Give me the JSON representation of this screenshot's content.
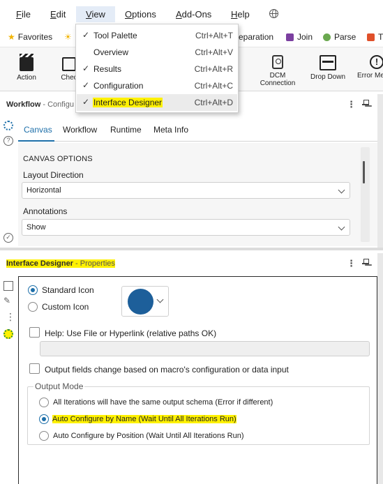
{
  "menubar": {
    "items": [
      {
        "label": "File",
        "accel": "F",
        "rest": "ile"
      },
      {
        "label": "Edit",
        "accel": "E",
        "rest": "dit"
      },
      {
        "label": "View",
        "accel": "V",
        "rest": "iew"
      },
      {
        "label": "Options",
        "accel": "O",
        "rest": "ptions"
      },
      {
        "label": "Add-Ons",
        "accel": "A",
        "rest": "dd-Ons"
      },
      {
        "label": "Help",
        "accel": "H",
        "rest": "elp"
      }
    ],
    "globe_icon": "globe-icon"
  },
  "favorites": {
    "items": [
      {
        "label": "Favorites",
        "icon": "star-icon",
        "color": "#f2b400"
      },
      {
        "label": "eparation",
        "color": ""
      },
      {
        "label": "Join",
        "icon": "join-icon",
        "color": "#7b3fa0"
      },
      {
        "label": "Parse",
        "icon": "parse-icon",
        "color": "#6aa84f"
      },
      {
        "label": "Tr",
        "icon": "transform-icon",
        "color": "#e0502a"
      }
    ]
  },
  "toolbar": {
    "tools": [
      {
        "label": "Action",
        "icon": "clapper-icon"
      },
      {
        "label": "Chec",
        "icon": "check-box-icon"
      },
      {
        "label_line1": "DCM",
        "label_line2": "Connection",
        "icon": "dcm-icon"
      },
      {
        "label": "Drop Down",
        "icon": "dropdown-icon"
      },
      {
        "label": "Error Me",
        "icon": "error-icon"
      }
    ]
  },
  "view_menu": {
    "items": [
      {
        "checked": true,
        "label": "Tool Palette",
        "shortcut": "Ctrl+Alt+T"
      },
      {
        "checked": false,
        "label": "Overview",
        "shortcut": "Ctrl+Alt+V"
      },
      {
        "checked": true,
        "label": "Results",
        "shortcut": "Ctrl+Alt+R"
      },
      {
        "checked": true,
        "label": "Configuration",
        "shortcut": "Ctrl+Alt+C"
      },
      {
        "checked": true,
        "label": "Interface Designer",
        "shortcut": "Ctrl+Alt+D"
      }
    ],
    "check_glyph": "✓"
  },
  "workflow_panel": {
    "title": "Workflow",
    "subtitle": " - Configu",
    "tabs": [
      "Canvas",
      "Workflow",
      "Runtime",
      "Meta Info"
    ],
    "active_tab": "Canvas",
    "section_heading": "CANVAS OPTIONS",
    "layout_direction_label": "Layout Direction",
    "layout_direction_value": "Horizontal",
    "annotations_label": "Annotations",
    "annotations_value": "Show"
  },
  "interface_designer": {
    "title": "Interface Designer",
    "subtitle": " - Properties",
    "standard_icon_label": "Standard Icon",
    "custom_icon_label": "Custom Icon",
    "icon_color": "#1d5f9a",
    "help_label": "Help: Use File or Hyperlink (relative paths OK)",
    "help_value": "",
    "output_fields_label": "Output fields change based on macro's configuration or data input",
    "output_mode_legend": "Output Mode",
    "output_modes": [
      {
        "label": "All Iterations will have the same output schema (Error if different)",
        "selected": false
      },
      {
        "label": "Auto Configure by Name (Wait Until All Iterations Run)",
        "selected": true
      },
      {
        "label": "Auto Configure by Position (Wait Until All Iterations Run)",
        "selected": false
      }
    ]
  },
  "colors": {
    "accent": "#1d6fa9",
    "highlight": "#fff100"
  }
}
